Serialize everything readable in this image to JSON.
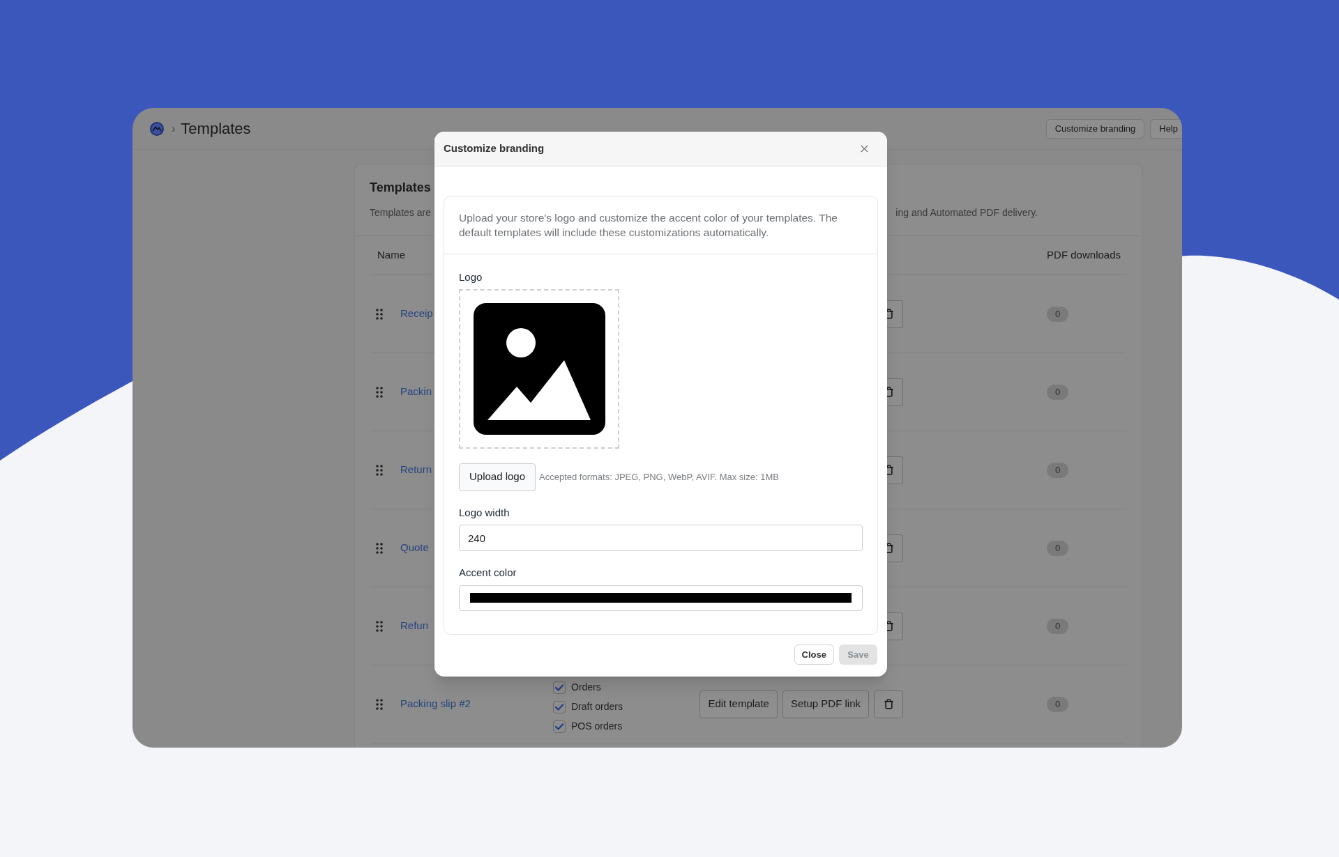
{
  "header": {
    "separator": "›",
    "title": "Templates",
    "buttons": [
      "Customize branding",
      "Help"
    ]
  },
  "card": {
    "title": "Templates",
    "description_parts": [
      "Templates are",
      "ing and Automated PDF delivery."
    ],
    "columns": [
      "Name",
      "PDF downloads"
    ],
    "rows": [
      {
        "name": "Receip",
        "pdf_downloads": "0"
      },
      {
        "name": "Packin",
        "pdf_downloads": "0"
      },
      {
        "name": "Return",
        "pdf_downloads": "0"
      },
      {
        "name": "Quote",
        "pdf_downloads": "0"
      },
      {
        "name": "Refun",
        "pdf_downloads": "0"
      },
      {
        "name": "Packing slip #2",
        "pdf_downloads": "0",
        "channels": [
          {
            "label": "Orders",
            "checked": true
          },
          {
            "label": "Draft orders",
            "checked": true
          },
          {
            "label": "POS orders",
            "checked": true
          }
        ],
        "buttons": [
          "Edit template",
          "Setup PDF link"
        ]
      }
    ]
  },
  "modal": {
    "title": "Customize branding",
    "description": "Upload your store's logo and customize the accent color of your templates. The default templates will include these customizations automatically.",
    "logo_label": "Logo",
    "upload_button": "Upload logo",
    "upload_hint": "Accepted formats: JPEG, PNG, WebP, AVIF. Max size: 1MB",
    "fields": [
      {
        "kind": "number",
        "label": "Logo width",
        "value": "240"
      },
      {
        "kind": "color",
        "label": "Accent color",
        "color": "#000000"
      }
    ],
    "buttons": [
      {
        "label": "Close",
        "disabled": false
      },
      {
        "label": "Save",
        "disabled": true
      }
    ]
  }
}
